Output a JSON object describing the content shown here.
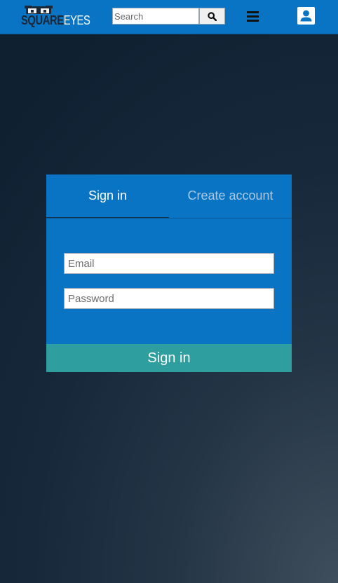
{
  "header": {
    "logo": {
      "part1": "SQUARE",
      "part2": "EYES"
    },
    "search": {
      "placeholder": "Search",
      "button_icon": "search-icon"
    },
    "menu_icon": "hamburger-menu-icon",
    "profile_icon": "user-profile-icon",
    "colors": {
      "background": "#0a74c4"
    }
  },
  "login": {
    "tabs": [
      {
        "label": "Sign in",
        "active": true
      },
      {
        "label": "Create account",
        "active": false
      }
    ],
    "fields": {
      "email": {
        "placeholder": "Email",
        "value": ""
      },
      "password": {
        "placeholder": "Password",
        "value": ""
      }
    },
    "submit_label": "Sign in",
    "colors": {
      "panel": "#0a74c4",
      "submit": "#2e9e9e"
    }
  }
}
